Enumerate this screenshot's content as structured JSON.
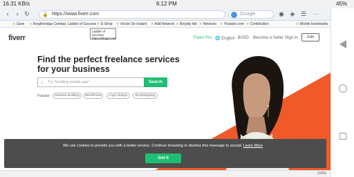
{
  "status": {
    "network": "16.31 KB/s",
    "time": "6:12 PM",
    "battery": "45%"
  },
  "browser": {
    "url": "https://www.fiverr.com",
    "search_placeholder": "Google",
    "bookmarks": [
      "Save",
      "Kingkhordap Combat",
      "Ladder of Success",
      "E-Shop",
      "Vector De Instant",
      "Add Network",
      "Royalty fde",
      "Newsvlo",
      "Youtube.com",
      "Contribution",
      "Mobile bookmarks"
    ],
    "tooltip": {
      "title": "Ladder of Success",
      "url": "https://blogns.net"
    },
    "zoom": "100%"
  },
  "fiverr": {
    "logo": "fiverr",
    "nav": {
      "pro": "Fiverr Pro",
      "language": "English",
      "currency": "$USD",
      "seller": "Become a Seller",
      "signin": "Sign In",
      "join": "Join"
    },
    "hero": {
      "title": "Find the perfect freelance services for your business",
      "search_placeholder": "Try \"building mobile app\"",
      "search_button": "Search",
      "popular_label": "Popular:",
      "popular": [
        "Website Building",
        "WordPress",
        "Logo Design",
        "Dropshipping"
      ]
    },
    "cookie": {
      "text": "We use cookies to provide you with a better service. Continue browsing or dismiss this message to accept.",
      "link": "Learn More",
      "button": "Got It"
    }
  },
  "colors": {
    "accent": "#1dbf73",
    "orange": "#f05a28",
    "cookie_bg": "#4d4d4d"
  }
}
